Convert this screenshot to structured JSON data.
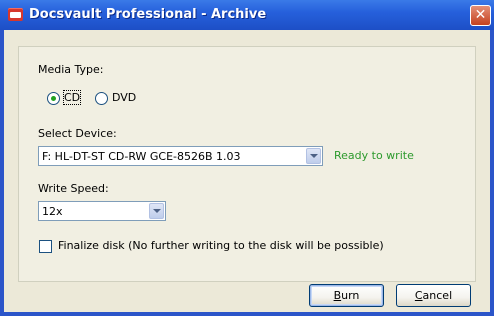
{
  "window": {
    "title": "Docsvault Professional - Archive",
    "close_glyph": "✕"
  },
  "media_type": {
    "label": "Media Type:",
    "options": [
      {
        "label": "CD",
        "selected": true
      },
      {
        "label": "DVD",
        "selected": false
      }
    ]
  },
  "device": {
    "label": "Select Device:",
    "value": "F: HL-DT-ST CD-RW GCE-8526B  1.03",
    "status": "Ready to write"
  },
  "speed": {
    "label": "Write Speed:",
    "value": "12x"
  },
  "finalize": {
    "label": "Finalize disk (No further writing to the disk will be possible)",
    "checked": false
  },
  "buttons": {
    "burn_first": "B",
    "burn_rest": "urn",
    "cancel_first": "C",
    "cancel_rest": "ancel"
  },
  "colors": {
    "status_green": "#2d9a2d",
    "title_blue": "#2660dc"
  }
}
